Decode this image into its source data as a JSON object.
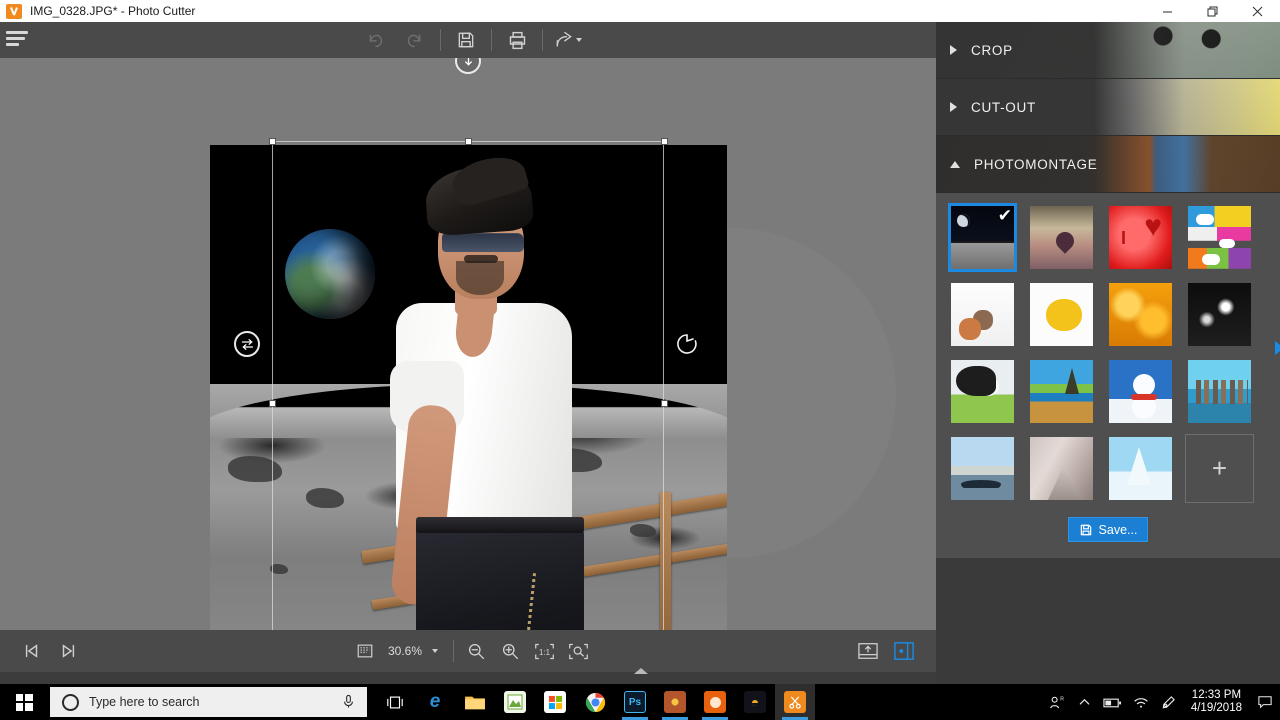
{
  "window": {
    "title": "IMG_0328.JPG* - Photo Cutter",
    "app_icon": "scissors-icon",
    "minimize_label": "Minimize",
    "restore_label": "Restore",
    "close_label": "Close"
  },
  "toolbar": {
    "menu_label": "Menu",
    "undo_label": "Undo",
    "redo_label": "Redo",
    "save_label": "Save",
    "print_label": "Print",
    "share_label": "Share"
  },
  "canvas": {
    "image_name": "IMG_0328.JPG",
    "selection": {
      "flip_handle": "flip-horizontal",
      "rotate_handle": "rotate",
      "move_down_handle": "move-down"
    }
  },
  "bottom_bar": {
    "first_image_label": "First image",
    "next_image_label": "Next image",
    "zoom_value": "30.6%",
    "zoom_selector_label": "Zoom level",
    "zoom_out_label": "Zoom out",
    "zoom_in_label": "Zoom in",
    "actual_size_label": "1:1",
    "fit_label": "Fit to window",
    "export_label": "Export",
    "panel_toggle_label": "Toggle side panel"
  },
  "right_panel": {
    "sections": [
      {
        "label": "CROP",
        "expanded": false
      },
      {
        "label": "CUT-OUT",
        "expanded": false
      },
      {
        "label": "PHOTOMONTAGE",
        "expanded": true
      }
    ],
    "thumbnails": [
      {
        "name": "moon-surface",
        "art": "t-moon",
        "selected": true
      },
      {
        "name": "heart-tree-sunset",
        "art": "t-heart-tree",
        "selected": false
      },
      {
        "name": "i-love-heart-red",
        "art": "t-ilove",
        "selected": false
      },
      {
        "name": "comic-speech-bubbles",
        "art": "t-comic",
        "selected": false
      },
      {
        "name": "kittens-white",
        "art": "t-cat",
        "selected": false
      },
      {
        "name": "yellow-monster",
        "art": "t-monster",
        "selected": false
      },
      {
        "name": "golden-bokeh",
        "art": "t-bokeh",
        "selected": false
      },
      {
        "name": "concert-lights",
        "art": "t-concert",
        "selected": false
      },
      {
        "name": "cow-meadow",
        "art": "t-cow",
        "selected": false
      },
      {
        "name": "eiffel-beach",
        "art": "t-eiffel",
        "selected": false
      },
      {
        "name": "snowman",
        "art": "t-snowman",
        "selected": false
      },
      {
        "name": "city-skyline",
        "art": "t-city",
        "selected": false
      },
      {
        "name": "venice-gondolas",
        "art": "t-venice",
        "selected": false
      },
      {
        "name": "cherry-blossom-path",
        "art": "t-blossom",
        "selected": false
      },
      {
        "name": "snowy-trees",
        "art": "t-snowtrees",
        "selected": false
      }
    ],
    "add_button_label": "+",
    "save_button_label": "Save...",
    "scroll_arrow": "right-arrow"
  },
  "taskbar": {
    "start_label": "Start",
    "search_placeholder": "Type here to search",
    "mic_label": "Microphone",
    "apps": [
      {
        "name": "task-view",
        "glyph": "▭",
        "bg": "transparent",
        "color": "#ffffff",
        "running": false,
        "active": false
      },
      {
        "name": "microsoft-edge",
        "glyph": "e",
        "bg": "transparent",
        "color": "#2b8fd6",
        "running": false,
        "active": false
      },
      {
        "name": "file-explorer",
        "glyph": "▰",
        "bg": "#f5b942",
        "color": "#ffffff",
        "running": false,
        "active": false
      },
      {
        "name": "green-editor-app",
        "glyph": "▤",
        "bg": "#eaf3e0",
        "color": "#4a8a2a",
        "running": false,
        "active": false
      },
      {
        "name": "microsoft-store",
        "glyph": "▣",
        "bg": "#ffffff",
        "color": "#d83b01",
        "running": false,
        "active": false
      },
      {
        "name": "google-chrome",
        "glyph": "◉",
        "bg": "#ffffff",
        "color": "#2b8fd6",
        "running": false,
        "active": false
      },
      {
        "name": "photoshop",
        "glyph": "Ps",
        "bg": "#0b1b2b",
        "color": "#3fb6f0",
        "running": true,
        "active": false
      },
      {
        "name": "pinwheel-app",
        "glyph": "✹",
        "bg": "#b3562b",
        "color": "#f5c542",
        "running": true,
        "active": false
      },
      {
        "name": "orange-photo-app",
        "glyph": "◕",
        "bg": "#e8610f",
        "color": "#ffe6cc",
        "running": true,
        "active": false
      },
      {
        "name": "flame-app",
        "glyph": "◓",
        "bg": "#12121a",
        "color": "#f5a623",
        "running": false,
        "active": false
      },
      {
        "name": "photo-cutter",
        "glyph": "✄",
        "bg": "#f08a1e",
        "color": "#ffffff",
        "running": true,
        "active": true
      }
    ],
    "tray": {
      "people_label": "People",
      "show_hidden_label": "Show hidden icons",
      "battery_label": "Battery",
      "network_label": "Network",
      "pen_label": "Pen",
      "time": "12:33 PM",
      "date": "4/19/2018",
      "notifications_label": "Notifications"
    }
  },
  "colors": {
    "accent": "#1b8ae0",
    "toolbar_bg": "#4a4a4a",
    "panel_bg": "#3a3a3a",
    "canvas_bg": "#7b7b7b",
    "app_icon": "#f08a1e"
  }
}
